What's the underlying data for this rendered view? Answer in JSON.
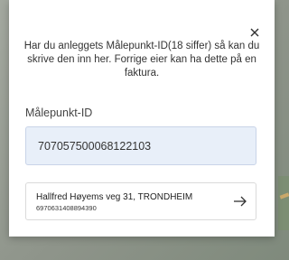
{
  "dialog": {
    "intro_text": "Har du anleggets Målepunkt-ID(18 siffer) så kan du skrive den inn her. Forrige eier kan ha dette på en faktura.",
    "close_icon": "close-icon"
  },
  "form": {
    "label": "Målepunkt-ID",
    "value": "707057500068122103"
  },
  "result": {
    "address": "Hallfred Høyems veg 31, TRONDHEIM",
    "meter_id": "6970631408894390",
    "icon": "arrow-right-icon"
  }
}
